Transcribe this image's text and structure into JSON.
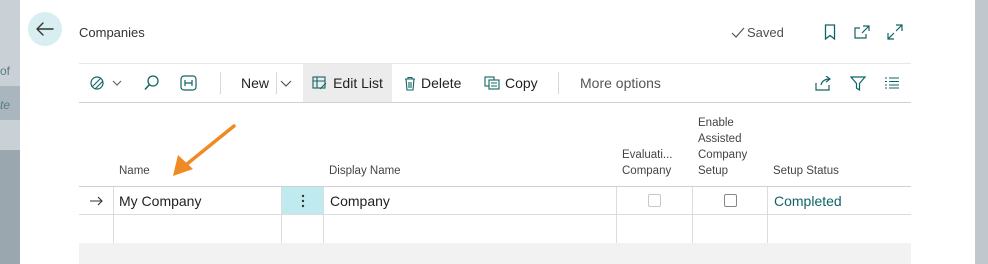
{
  "page": {
    "title": "Companies",
    "status": "Saved"
  },
  "background": {
    "left_text_1": "of",
    "left_text_2": "te"
  },
  "toolbar": {
    "new_label": "New",
    "edit_list_label": "Edit List",
    "delete_label": "Delete",
    "copy_label": "Copy",
    "more_options_label": "More options"
  },
  "table": {
    "headers": {
      "name": "Name",
      "display_name": "Display Name",
      "evaluation_company_1": "Evaluati...",
      "evaluation_company_2": "Company",
      "assisted_1": "Enable",
      "assisted_2": "Assisted",
      "assisted_3": "Company",
      "assisted_4": "Setup",
      "setup_status": "Setup Status"
    },
    "rows": [
      {
        "name": "My Company",
        "display_name": "Company",
        "evaluation_company": false,
        "enable_assisted_setup": false,
        "setup_status": "Completed"
      }
    ]
  },
  "colors": {
    "accent": "#116466",
    "back_button_bg": "#d9eef0",
    "selected_cell": "#bfeaef",
    "annotation_arrow": "#f08a24"
  }
}
